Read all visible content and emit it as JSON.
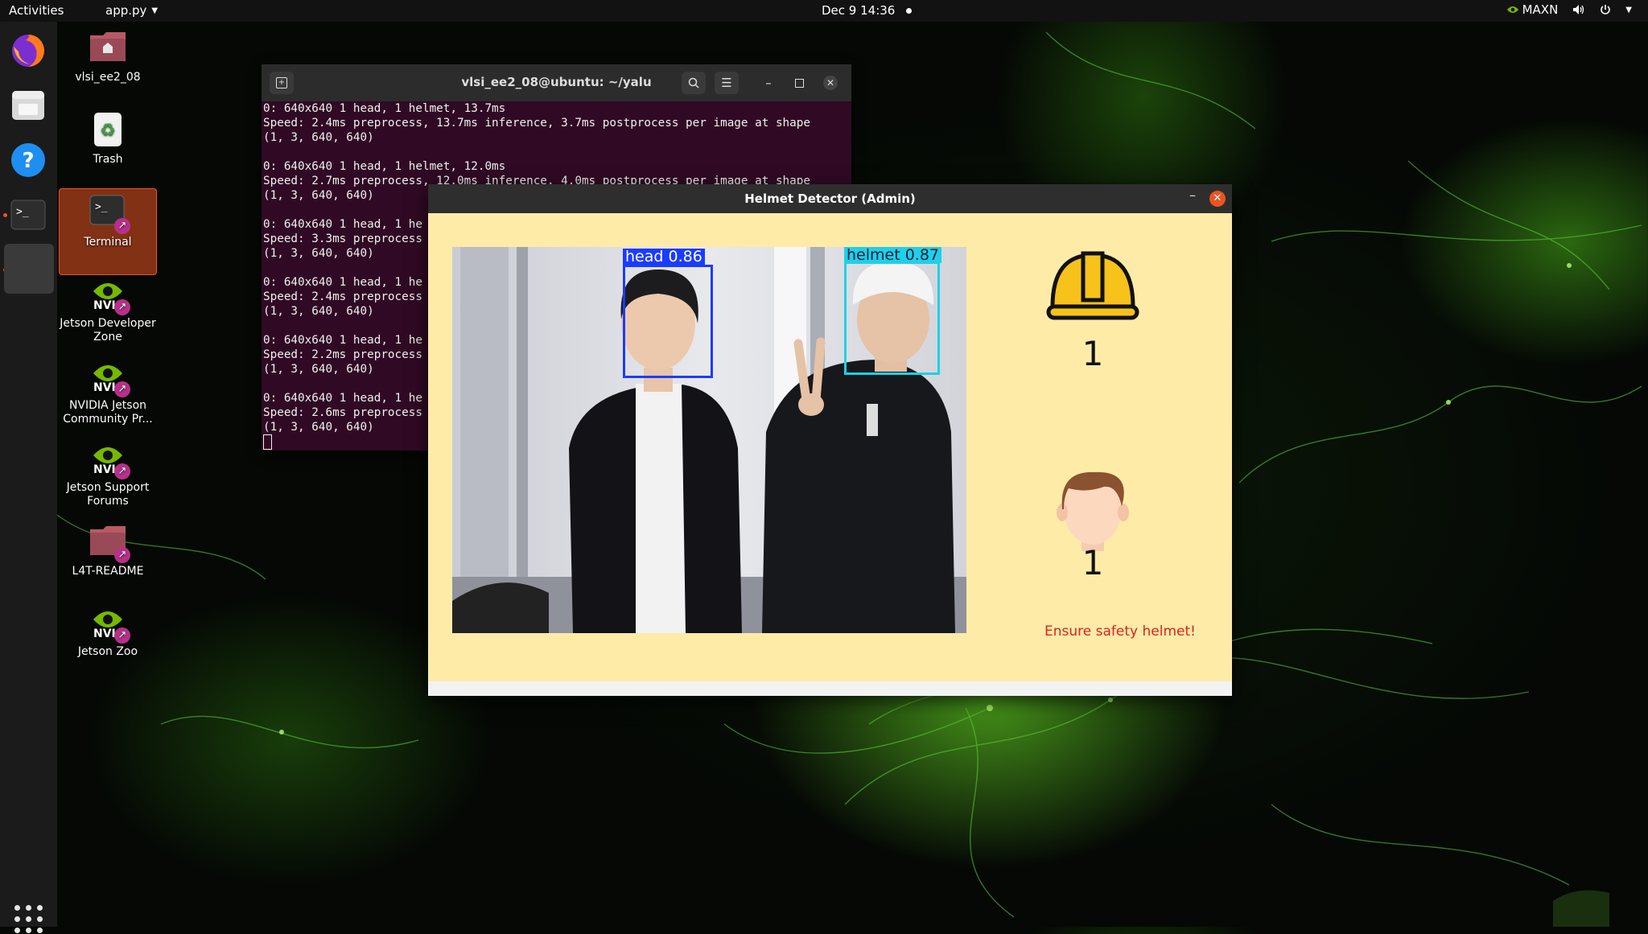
{
  "topbar": {
    "activities": "Activities",
    "app_menu": "app.py",
    "clock": "Dec 9  14:36",
    "power_mode": "MAXN"
  },
  "dock": {
    "items": [
      "firefox-icon",
      "files-icon",
      "help-icon",
      "terminal-icon",
      "blank-app-icon"
    ],
    "show_apps": "apps-grid-icon"
  },
  "desktop_icons": [
    {
      "label": "vlsi_ee2_08",
      "icon": "home-folder-icon"
    },
    {
      "label": "Trash",
      "icon": "trash-icon"
    },
    {
      "label": "Terminal",
      "icon": "terminal-launcher-icon"
    },
    {
      "label": "Jetson Developer Zone",
      "icon": "nvidia-link-icon"
    },
    {
      "label": "NVIDIA Jetson Community Pr...",
      "icon": "nvidia-link-icon"
    },
    {
      "label": "Jetson Support Forums",
      "icon": "nvidia-link-icon"
    },
    {
      "label": "L4T-README",
      "icon": "folder-link-icon"
    },
    {
      "label": "Jetson Zoo",
      "icon": "nvidia-link-icon"
    }
  ],
  "terminal": {
    "title": "vlsi_ee2_08@ubuntu: ~/yalu",
    "lines": [
      "0: 640x640 1 head, 1 helmet, 13.7ms",
      "Speed: 2.4ms preprocess, 13.7ms inference, 3.7ms postprocess per image at shape",
      "(1, 3, 640, 640)",
      "",
      "0: 640x640 1 head, 1 helmet, 12.0ms",
      "Speed: 2.7ms preprocess, 12.0ms inference, 4.0ms postprocess per image at shape",
      "(1, 3, 640, 640)",
      "",
      "0: 640x640 1 head, 1 he",
      "Speed: 3.3ms preprocess",
      "(1, 3, 640, 640)",
      "",
      "0: 640x640 1 head, 1 he",
      "Speed: 2.4ms preprocess",
      "(1, 3, 640, 640)",
      "",
      "0: 640x640 1 head, 1 he",
      "Speed: 2.2ms preprocess",
      "(1, 3, 640, 640)",
      "",
      "0: 640x640 1 head, 1 he",
      "Speed: 2.6ms preprocess",
      "(1, 3, 640, 640)"
    ]
  },
  "app": {
    "title": "Helmet Detector (Admin)",
    "detections": [
      {
        "label": "head 0.86",
        "color": "#1a3cff"
      },
      {
        "label": "helmet 0.87",
        "color": "#1fd0e8"
      }
    ],
    "helmet_count": "1",
    "head_count": "1",
    "warning": "Ensure safety helmet!"
  },
  "colors": {
    "accent": "#e95420",
    "terminal_bg": "#300a24",
    "app_bg": "#ffeba8",
    "warning": "#e02020"
  }
}
